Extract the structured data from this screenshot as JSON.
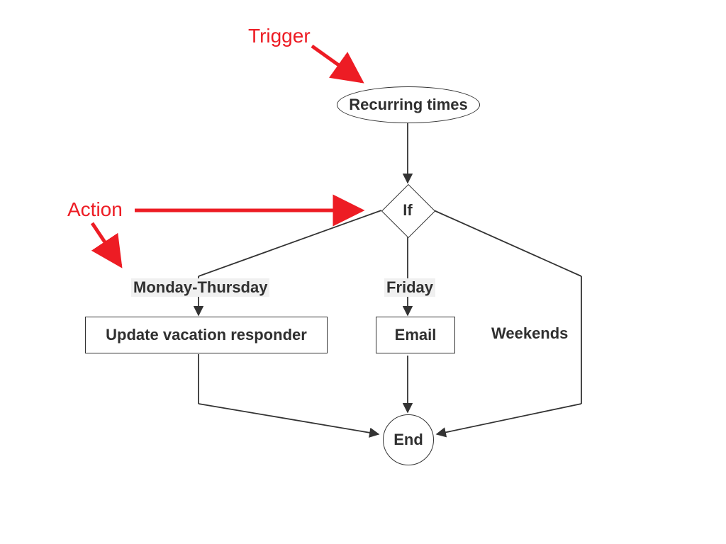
{
  "annotations": {
    "trigger": "Trigger",
    "action": "Action"
  },
  "nodes": {
    "start": "Recurring times",
    "decision": "If",
    "end": "End",
    "branch_a_label": "Monday-Thursday",
    "branch_a_action": "Update vacation responder",
    "branch_b_label": "Friday",
    "branch_b_action": "Email",
    "branch_c_label": "Weekends"
  },
  "chart_data": {
    "type": "flowchart",
    "title": "",
    "nodes": [
      {
        "id": "start",
        "shape": "ellipse",
        "label": "Recurring times",
        "role": "Trigger"
      },
      {
        "id": "decision",
        "shape": "diamond",
        "label": "If",
        "role": "Action"
      },
      {
        "id": "act_a",
        "shape": "rect",
        "label": "Update vacation responder"
      },
      {
        "id": "act_b",
        "shape": "rect",
        "label": "Email"
      },
      {
        "id": "end",
        "shape": "circle",
        "label": "End"
      }
    ],
    "edges": [
      {
        "from": "start",
        "to": "decision",
        "label": ""
      },
      {
        "from": "decision",
        "to": "act_a",
        "label": "Monday-Thursday"
      },
      {
        "from": "decision",
        "to": "act_b",
        "label": "Friday"
      },
      {
        "from": "decision",
        "to": "end",
        "label": "Weekends"
      },
      {
        "from": "act_a",
        "to": "end",
        "label": ""
      },
      {
        "from": "act_b",
        "to": "end",
        "label": ""
      }
    ],
    "annotations": [
      {
        "text": "Trigger",
        "points_to": "start",
        "color": "#ed1c24"
      },
      {
        "text": "Action",
        "points_to": "decision",
        "color": "#ed1c24"
      }
    ]
  }
}
